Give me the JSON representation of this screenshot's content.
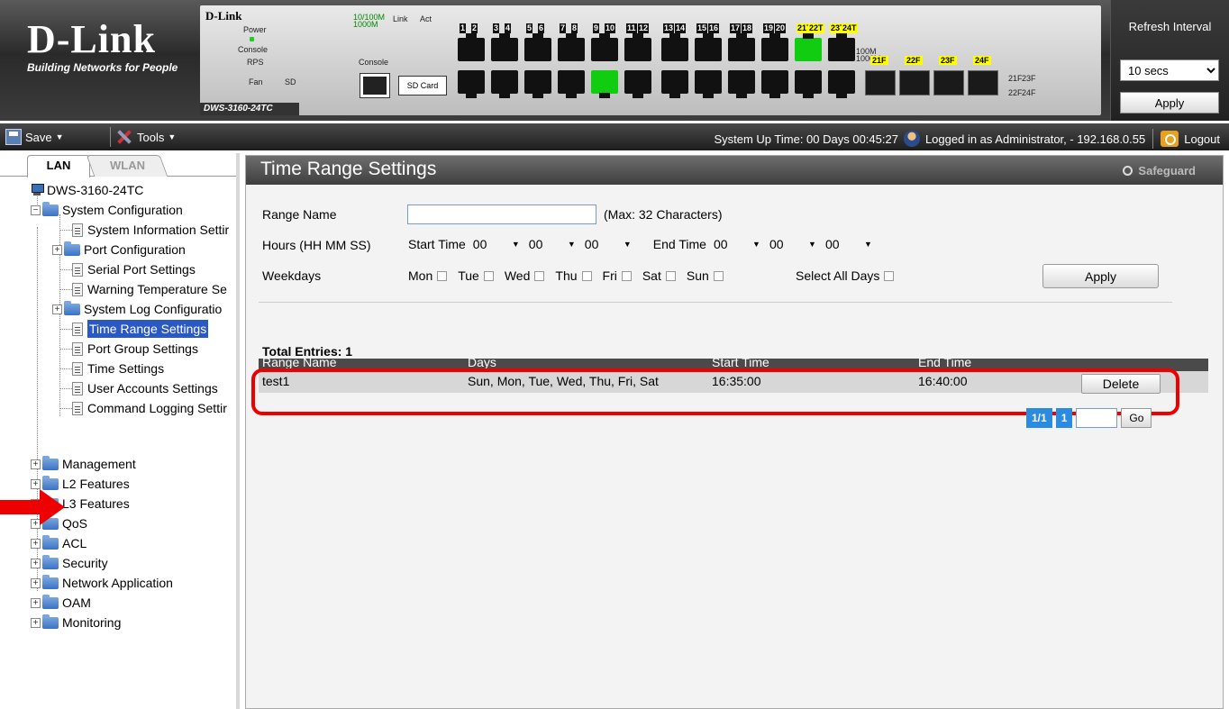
{
  "brand": {
    "logo": "D-Link",
    "tagline": "Building Networks for People"
  },
  "device": {
    "name": "D-Link",
    "model": "DWS-3160-24TC",
    "led_labels": {
      "power": "Power",
      "console": "Console",
      "rps": "RPS",
      "fan": "Fan",
      "sd": "SD",
      "speed1": "10/100M",
      "speed2": "1000M",
      "link": "Link",
      "act": "Act",
      "sfp_speed1": "100M",
      "sfp_speed2": "1000M"
    },
    "console_label": "Console",
    "sd_card_label": "SD Card",
    "port_numbers": [
      "1",
      "2",
      "3",
      "4",
      "5",
      "6",
      "7",
      "8",
      "9",
      "10",
      "11",
      "12",
      "13",
      "14",
      "15",
      "16",
      "17",
      "18",
      "19",
      "20",
      "21T",
      "22T",
      "23T",
      "24T"
    ],
    "sfp_labels": [
      "21F",
      "22F",
      "23F",
      "24F"
    ],
    "sfp_side": {
      "a": "21F",
      "b": "23F",
      "c": "22F",
      "d": "24F"
    }
  },
  "refresh": {
    "title": "Refresh Interval",
    "value": "10 secs",
    "apply": "Apply"
  },
  "toolbar": {
    "save": "Save",
    "tools": "Tools",
    "uptime": "System Up Time: 00 Days 00:45:27",
    "login": "Logged in as Administrator, - 192.168.0.55",
    "logout": "Logout"
  },
  "tabs": {
    "lan": "LAN",
    "wlan": "WLAN"
  },
  "tree": {
    "root": "DWS-3160-24TC",
    "system_configuration": "System Configuration",
    "children": [
      "System Information Settir",
      "Port Configuration",
      "Serial Port Settings",
      "Warning Temperature Se",
      "System Log Configuratio",
      "Time Range Settings",
      "Port Group Settings",
      "Time Settings",
      "User Accounts Settings",
      "Command Logging Settir"
    ],
    "top_level": [
      "Management",
      "L2 Features",
      "L3 Features",
      "QoS",
      "ACL",
      "Security",
      "Network Application",
      "OAM",
      "Monitoring"
    ]
  },
  "main": {
    "title": "Time Range Settings",
    "safeguard": "Safeguard",
    "form": {
      "range_name_label": "Range Name",
      "range_name_value": "",
      "max_chars": "(Max: 32 Characters)",
      "hours_label": "Hours (HH MM SS)",
      "start_time_label": "Start Time",
      "end_time_label": "End Time",
      "start_hh": "00",
      "start_mm": "00",
      "start_ss": "00",
      "end_hh": "00",
      "end_mm": "00",
      "end_ss": "00",
      "weekdays_label": "Weekdays",
      "days": [
        "Mon",
        "Tue",
        "Wed",
        "Thu",
        "Fri",
        "Sat",
        "Sun"
      ],
      "select_all": "Select All Days",
      "apply": "Apply"
    },
    "total_entries": "Total Entries: 1",
    "table": {
      "headers": [
        "Range Name",
        "Days",
        "Start Time",
        "End Time"
      ],
      "rows": [
        {
          "name": "test1",
          "days": "Sun, Mon, Tue, Wed, Thu, Fri, Sat",
          "start": "16:35:00",
          "end": "16:40:00",
          "action": "Delete"
        }
      ]
    },
    "pager": {
      "pages": "1/1",
      "current": "1",
      "go": "Go"
    }
  },
  "colors": {
    "highlight": "#e00000",
    "selected": "#2b59c3",
    "pager": "#2a8be0",
    "arrow": "#e00000"
  }
}
